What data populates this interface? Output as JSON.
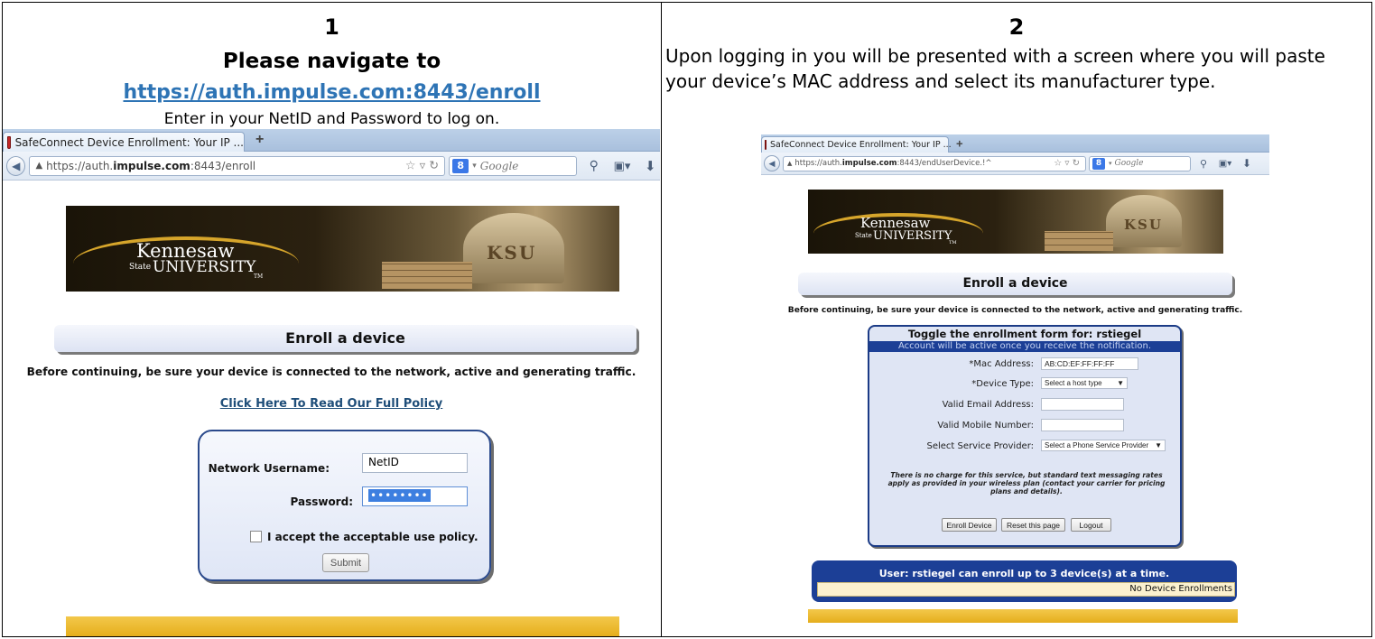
{
  "step1": {
    "number": "1",
    "heading": "Please navigate to",
    "link": "https://auth.impulse.com:8443/enroll",
    "instruction": "Enter in your NetID and Password to log on.",
    "browser": {
      "tab_title": "SafeConnect Device Enrollment: Your IP ...",
      "tab_new": "+",
      "url_prefix": "https://auth.",
      "url_domain": "impulse.com",
      "url_suffix": ":8443/enroll",
      "search_engine_badge": "8",
      "search_placeholder": "Google"
    },
    "banner": {
      "brand_line1": "Kennesaw",
      "brand_state": "State",
      "brand_line2": "UNIVERSITY",
      "tm": "TM",
      "building_letters": "KSU"
    },
    "page": {
      "header": "Enroll a device",
      "notice": "Before continuing, be sure your device is connected to the network, active and generating traffic.",
      "policy_link": "Click Here To Read Our Full Policy",
      "username_label": "Network Username:",
      "username_value": "NetID",
      "password_label": "Password:",
      "password_value": "••••••••",
      "accept_label": "I accept the acceptable use policy.",
      "submit_label": "Submit"
    }
  },
  "step2": {
    "number": "2",
    "description": "Upon logging in you will be presented with a screen where you will paste your device’s MAC address and select its manufacturer type.",
    "browser": {
      "tab_title": "SafeConnect Device Enrollment: Your IP ...",
      "tab_new": "+",
      "url_prefix": "https://auth.",
      "url_domain": "impulse.com",
      "url_suffix": ":8443/endUserDevice.!^",
      "search_engine_badge": "8",
      "search_placeholder": "Google"
    },
    "banner": {
      "brand_line1": "Kennesaw",
      "brand_state": "State",
      "brand_line2": "UNIVERSITY",
      "tm": "TM",
      "building_letters": "KSU"
    },
    "page": {
      "header": "Enroll a device",
      "notice": "Before continuing, be sure your device is connected to the network, active and generating traffic.",
      "form_title": "Toggle the enrollment form for: rstiegel",
      "form_notice": "Account will be active once you receive the notification.",
      "mac_label": "*Mac Address:",
      "mac_value": "AB:CD:EF:FF:FF:FF",
      "device_type_label": "*Device Type:",
      "device_type_value": "Select a host type",
      "email_label": "Valid Email Address:",
      "mobile_label": "Valid Mobile Number:",
      "provider_label": "Select Service Provider:",
      "provider_value": "Select a Phone Service Provider",
      "charge_note": "There is no charge for this service, but standard text messaging rates apply as provided in your wireless plan (contact your carrier for pricing plans and details).",
      "enroll_button": "Enroll Device",
      "reset_button": "Reset this page",
      "logout_button": "Logout",
      "user_limit": "User: rstiegel can enroll up to 3 device(s) at a time.",
      "enrollments_status": "No Device Enrollments"
    }
  }
}
